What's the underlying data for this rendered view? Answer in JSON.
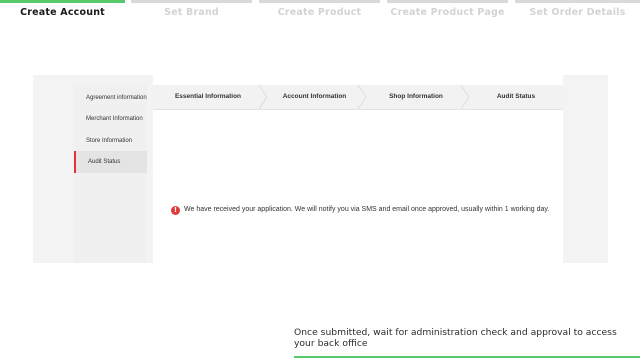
{
  "steps": [
    {
      "label": "Create Account",
      "active": true
    },
    {
      "label": "Set Brand",
      "active": false
    },
    {
      "label": "Create Product",
      "active": false
    },
    {
      "label": "Create Product Page",
      "active": false
    },
    {
      "label": "Set Order Details",
      "active": false
    }
  ],
  "sidebar": {
    "items": [
      {
        "label": "Agreement information"
      },
      {
        "label": "Merchant Information"
      },
      {
        "label": "Store Information"
      },
      {
        "label": "Audit Status",
        "active": true
      }
    ]
  },
  "tabs": [
    {
      "label": "Essential Information"
    },
    {
      "label": "Account Information"
    },
    {
      "label": "Shop Information"
    },
    {
      "label": "Audit Status"
    }
  ],
  "notice": {
    "icon": "error-icon",
    "text": "We have received your application. We will notify you via SMS and email once approved, usually within 1 working day."
  },
  "caption": {
    "text": "Once submitted, wait for administration check and approval to access your back office"
  },
  "colors": {
    "accent_green": "#57c96b",
    "active_red": "#e0303a",
    "error_red": "#e03a3a"
  }
}
